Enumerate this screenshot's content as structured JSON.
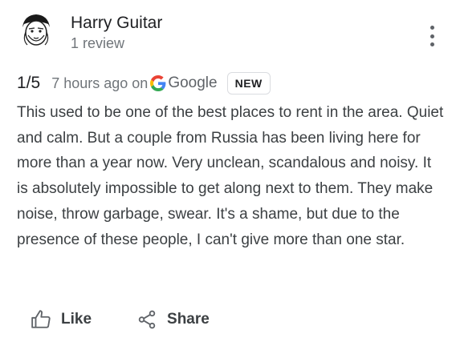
{
  "author": {
    "name": "Harry Guitar",
    "reviews": "1 review"
  },
  "review": {
    "rating": "1/5",
    "time": "7 hours ago",
    "on": "on",
    "source": "Google",
    "badge": "NEW",
    "text": "This used to be one of the best places to rent in the area. Quiet and calm. But a couple from Russia has been living here for more than a year now. Very unclean, scandalous and noisy. It is absolutely impossible to get along next to them. They make noise, throw garbage, swear. It's a shame, but due to the presence of these people, I can't give more than one star."
  },
  "actions": {
    "like": "Like",
    "share": "Share"
  },
  "icons": {
    "more": "more-vert-icon",
    "like": "thumbs-up-icon",
    "share": "share-icon",
    "google": "google-g-icon"
  },
  "colors": {
    "google_blue": "#4285F4",
    "google_red": "#EA4335",
    "google_yellow": "#FBBC05",
    "google_green": "#34A853"
  }
}
